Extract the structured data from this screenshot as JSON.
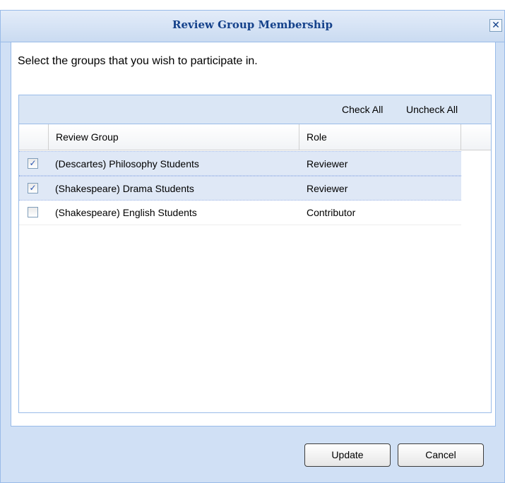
{
  "dialog": {
    "title": "Review Group Membership",
    "close_glyph": "✕",
    "instructions": "Select the groups that you wish to participate in."
  },
  "toolbar": {
    "check_all_label": "Check All",
    "uncheck_all_label": "Uncheck All"
  },
  "grid": {
    "columns": [
      "Review Group",
      "Role"
    ],
    "rows": [
      {
        "checked": true,
        "checkmark": "✓",
        "group": "(Descartes) Philosophy Students",
        "role": "Reviewer"
      },
      {
        "checked": true,
        "checkmark": "✓",
        "group": "(Shakespeare) Drama Students",
        "role": "Reviewer"
      },
      {
        "checked": false,
        "checkmark": "",
        "group": "(Shakespeare) English Students",
        "role": "Contributor"
      }
    ]
  },
  "buttons": {
    "update_label": "Update",
    "cancel_label": "Cancel"
  },
  "colors": {
    "title_text": "#15428b",
    "selected_row": "#dfe8f6",
    "dialog_frame": "#d0e0f5"
  }
}
